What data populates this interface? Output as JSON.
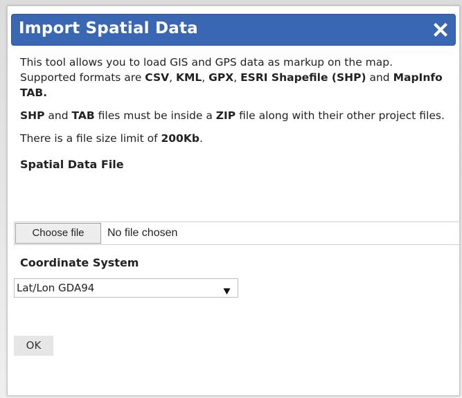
{
  "dialog": {
    "title": "Import Spatial Data",
    "close_icon": "close-icon"
  },
  "intro": {
    "p1": [
      {
        "text": "This tool allows you to load GIS and GPS data as markup on the map. Supported formats are ",
        "bold": false
      },
      {
        "text": "CSV",
        "bold": true
      },
      {
        "text": ", ",
        "bold": false
      },
      {
        "text": "KML",
        "bold": true
      },
      {
        "text": ", ",
        "bold": false
      },
      {
        "text": "GPX",
        "bold": true
      },
      {
        "text": ", ",
        "bold": false
      },
      {
        "text": "ESRI Shapefile (SHP)",
        "bold": true
      },
      {
        "text": " and ",
        "bold": false
      },
      {
        "text": "MapInfo TAB.",
        "bold": true
      }
    ],
    "p2": [
      {
        "text": "SHP",
        "bold": true
      },
      {
        "text": " and ",
        "bold": false
      },
      {
        "text": "TAB",
        "bold": true
      },
      {
        "text": " files must be inside a ",
        "bold": false
      },
      {
        "text": "ZIP",
        "bold": true
      },
      {
        "text": " file along with their other project files.",
        "bold": false
      }
    ],
    "p3": [
      {
        "text": "There is a file size limit of ",
        "bold": false
      },
      {
        "text": "200Kb",
        "bold": true
      },
      {
        "text": ".",
        "bold": false
      }
    ]
  },
  "spatial_file": {
    "label": "Spatial Data File",
    "button_label": "Choose file",
    "status": "No file chosen"
  },
  "coordinate_system": {
    "label": "Coordinate System",
    "selected": "Lat/Lon GDA94"
  },
  "actions": {
    "ok_label": "OK"
  },
  "colors": {
    "titlebar": "#3a67b3",
    "title_text": "#ffffff"
  }
}
